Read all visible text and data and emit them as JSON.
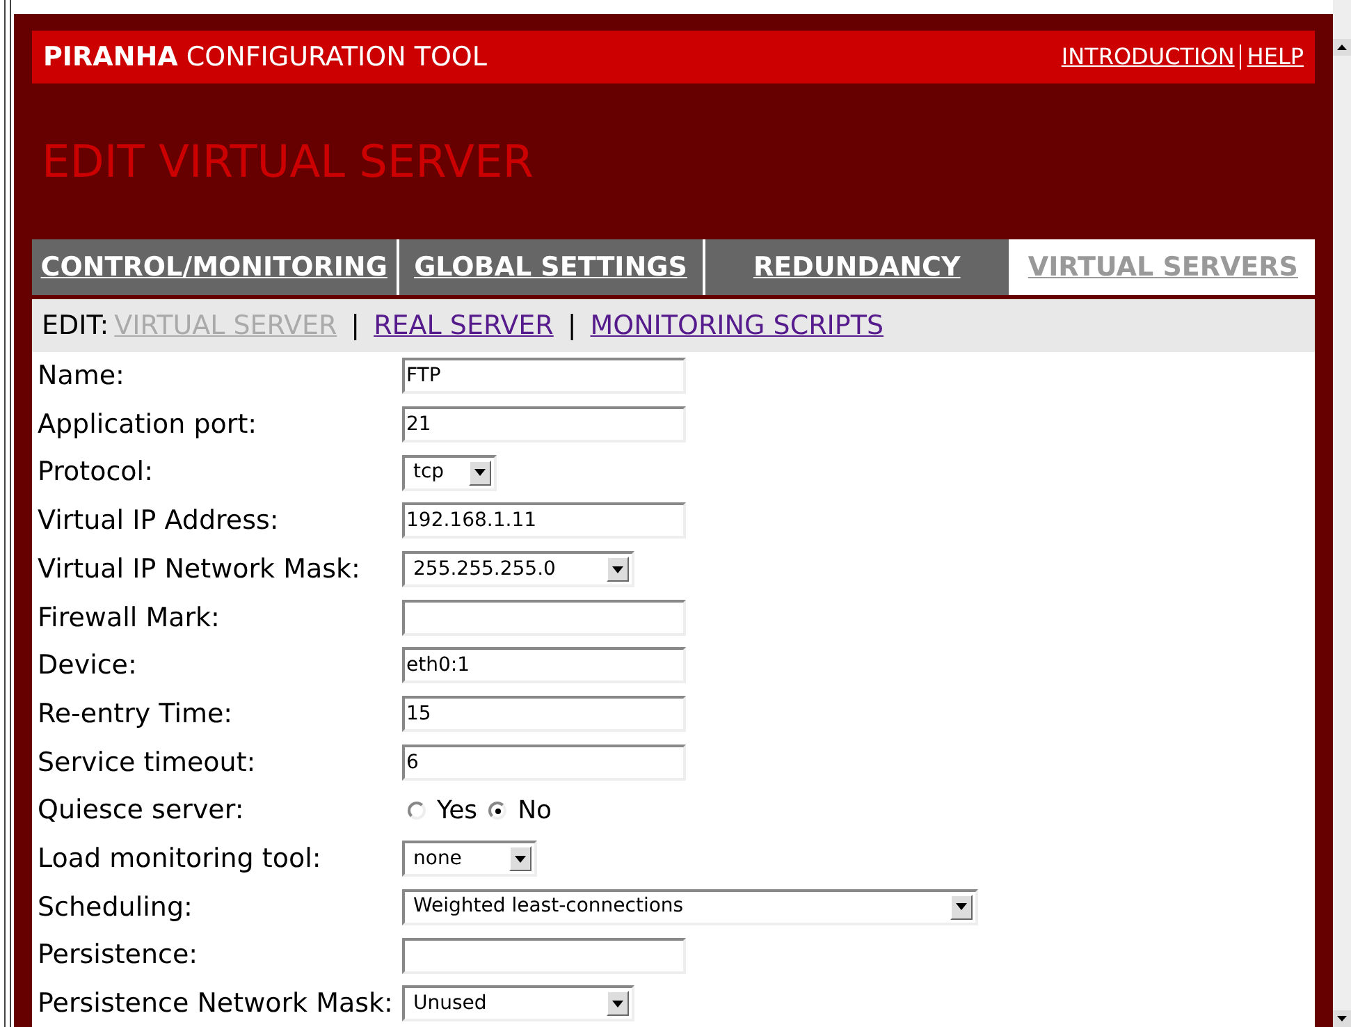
{
  "header": {
    "brand": "PIRANHA",
    "title": "CONFIGURATION TOOL",
    "links": [
      "INTRODUCTION",
      "HELP"
    ]
  },
  "page_title": "EDIT VIRTUAL SERVER",
  "tabs": [
    {
      "label": "CONTROL/MONITORING",
      "selected": false
    },
    {
      "label": "GLOBAL SETTINGS",
      "selected": false
    },
    {
      "label": "REDUNDANCY",
      "selected": false
    },
    {
      "label": "VIRTUAL SERVERS",
      "selected": true
    }
  ],
  "subnav": {
    "label": "EDIT:",
    "separator": "|",
    "links": [
      {
        "label": "VIRTUAL SERVER",
        "selected": true
      },
      {
        "label": "REAL SERVER",
        "selected": false
      },
      {
        "label": "MONITORING SCRIPTS",
        "selected": false
      }
    ]
  },
  "form": [
    {
      "kind": "text",
      "label": "Name:",
      "value": "FTP"
    },
    {
      "kind": "text",
      "label": "Application port:",
      "value": "21"
    },
    {
      "kind": "select",
      "label": "Protocol:",
      "value": "tcp"
    },
    {
      "kind": "text",
      "label": "Virtual IP Address:",
      "value": "192.168.1.11"
    },
    {
      "kind": "select",
      "label": "Virtual IP Network Mask:",
      "value": "255.255.255.0"
    },
    {
      "kind": "text",
      "label": "Firewall Mark:"
    },
    {
      "kind": "text",
      "label": "Device:",
      "value": "eth0:1"
    },
    {
      "kind": "text",
      "label": "Re-entry Time:",
      "value": "15"
    },
    {
      "kind": "text",
      "label": "Service timeout:",
      "value": "6"
    },
    {
      "kind": "radio",
      "label": "Quiesce server:",
      "options": [
        {
          "label": "Yes",
          "selected": false
        },
        {
          "label": "No",
          "selected": true
        }
      ]
    },
    {
      "kind": "select",
      "label": "Load monitoring tool:",
      "value": "none"
    },
    {
      "kind": "select",
      "label": "Scheduling:",
      "value": "Weighted least-connections"
    },
    {
      "kind": "text",
      "label": "Persistence:"
    },
    {
      "kind": "select",
      "label": "Persistence Network Mask:",
      "value": "Unused"
    }
  ]
}
